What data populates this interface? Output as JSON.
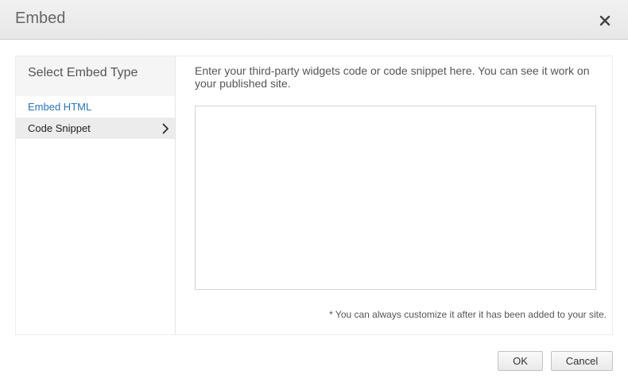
{
  "dialog": {
    "title": "Embed",
    "close_icon": "close-icon"
  },
  "sidebar": {
    "heading": "Select Embed Type",
    "items": [
      {
        "label": "Embed HTML",
        "selected": false
      },
      {
        "label": "Code Snippet",
        "selected": true,
        "icon": "chevron-right-icon"
      }
    ]
  },
  "content": {
    "instructions": "Enter your third-party widgets code or code snippet here. You can see it work on your published site.",
    "code_value": "",
    "note": "* You can always customize it after it has been added to your site."
  },
  "footer": {
    "ok_label": "OK",
    "cancel_label": "Cancel"
  },
  "colors": {
    "link": "#2a73b5",
    "selected_bg": "#ececec",
    "header_bg": "#eeeeee"
  }
}
